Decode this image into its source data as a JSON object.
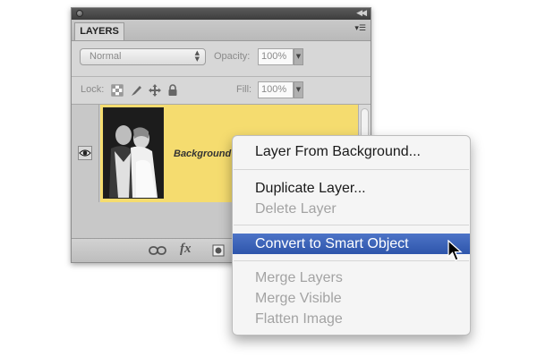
{
  "panel": {
    "tab_label": "LAYERS",
    "blend_mode": "Normal",
    "opacity_label": "Opacity:",
    "opacity_value": "100%",
    "lock_label": "Lock:",
    "fill_label": "Fill:",
    "fill_value": "100%",
    "layer": {
      "name": "Background",
      "row_color": "#f5dc6f"
    }
  },
  "context_menu": {
    "items": [
      {
        "label": "Layer From Background...",
        "enabled": true
      },
      {
        "label": "Duplicate Layer...",
        "enabled": true
      },
      {
        "label": "Delete Layer",
        "enabled": false
      },
      {
        "label": "Convert to Smart Object",
        "enabled": true,
        "highlighted": true
      },
      {
        "label": "Merge Layers",
        "enabled": false
      },
      {
        "label": "Merge Visible",
        "enabled": false
      },
      {
        "label": "Flatten Image",
        "enabled": false
      }
    ],
    "highlight_color": "#3a62b8"
  },
  "icons": {
    "lock_row": [
      "lock-transparent-pixels-icon",
      "lock-image-pixels-icon",
      "lock-position-icon",
      "lock-all-icon"
    ],
    "bottom_bar": [
      "link-layers-icon",
      "layer-style-fx-icon",
      "add-mask-icon"
    ],
    "visibility": "eye-icon",
    "cursor": "arrow-cursor-icon"
  }
}
